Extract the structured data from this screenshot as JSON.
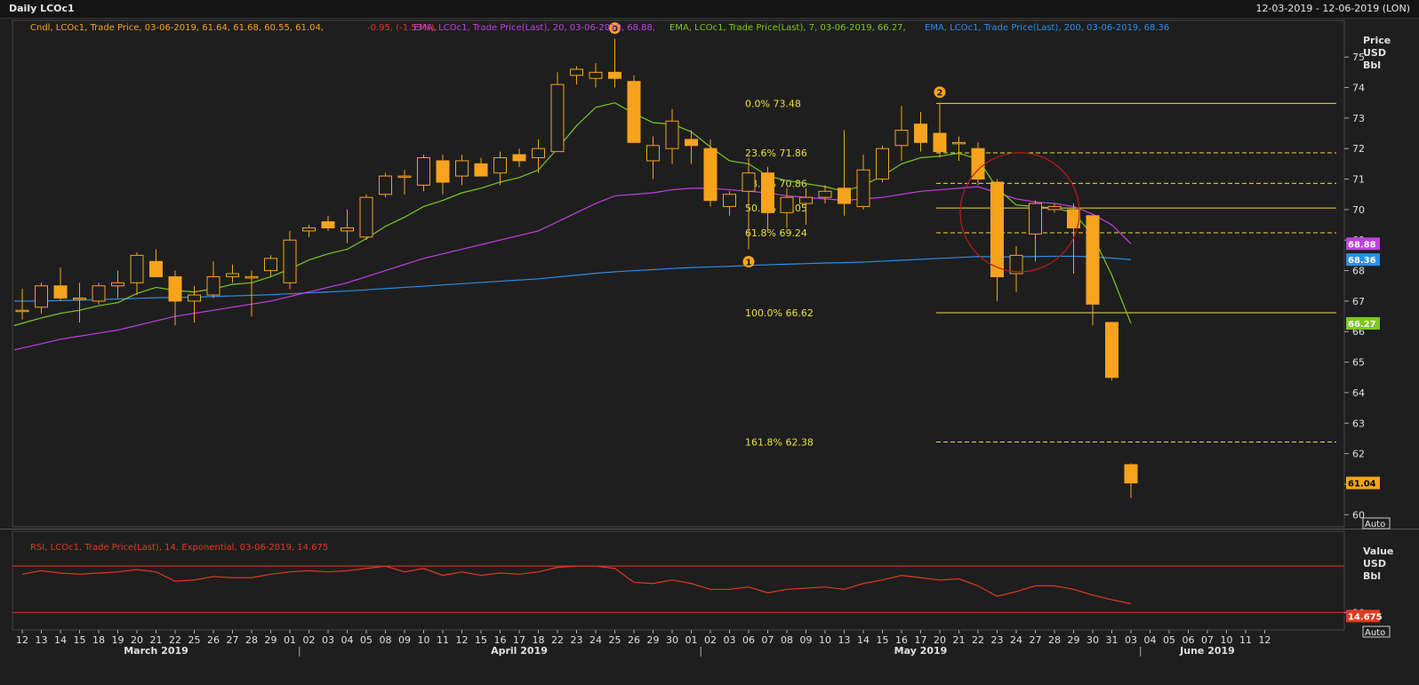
{
  "window": {
    "title": "Daily LCOc1",
    "date_range": "12-03-2019 - 12-06-2019 (LON)"
  },
  "legend": {
    "candle": "Cndl, LCOc1, Trade Price,  03-06-2019, 61.64, 61.68, 60.55, 61.04,",
    "candle_change": "-0.95, (-1.53%),",
    "ema20": "EMA, LCOc1, Trade Price(Last),  20, 03-06-2019, 68.88,",
    "ema7": "EMA, LCOc1, Trade Price(Last),  7, 03-06-2019, 66.27,",
    "ema200": "EMA, LCOc1, Trade Price(Last),  200, 03-06-2019, 68.36",
    "rsi": "RSI, LCOc1, Trade Price(Last),  14, Exponential, 03-06-2019, 14.675"
  },
  "axis": {
    "price_title": [
      "Price",
      "USD",
      "Bbl"
    ],
    "rsi_title": [
      "Value",
      "USD",
      "Bbl"
    ],
    "auto_label": "Auto",
    "months": [
      "March 2019",
      "April 2019",
      "May 2019",
      "June 2019"
    ]
  },
  "colors": {
    "bg": "#1e1e1e",
    "grid": "#3a3a3a",
    "candle_up": "#f7a31c",
    "ema20": "#c040e0",
    "ema7": "#7ec820",
    "ema200": "#2a8fe8",
    "fib": "#e8e040",
    "rsi": "#e03a20",
    "circle": "#c01818",
    "axis_text": "#e0e0e0"
  },
  "chart_data": {
    "type": "candlestick",
    "x": [
      "12",
      "13",
      "14",
      "15",
      "18",
      "19",
      "20",
      "21",
      "22",
      "25",
      "26",
      "27",
      "28",
      "29",
      "01",
      "02",
      "03",
      "04",
      "05",
      "08",
      "09",
      "10",
      "11",
      "12",
      "15",
      "16",
      "17",
      "18",
      "22",
      "23",
      "24",
      "25",
      "26",
      "29",
      "30",
      "01",
      "02",
      "03",
      "06",
      "07",
      "08",
      "09",
      "10",
      "13",
      "14",
      "15",
      "16",
      "17",
      "20",
      "21",
      "22",
      "23",
      "24",
      "27",
      "28",
      "29",
      "30",
      "31",
      "03"
    ],
    "x_future": [
      "04",
      "05",
      "06",
      "07",
      "10",
      "11",
      "12"
    ],
    "ohlc": [
      [
        66.7,
        67.4,
        66.4,
        66.7
      ],
      [
        66.8,
        67.6,
        66.6,
        67.5
      ],
      [
        67.5,
        68.1,
        67.0,
        67.1
      ],
      [
        67.1,
        67.6,
        66.3,
        67.1
      ],
      [
        67.0,
        67.6,
        66.9,
        67.5
      ],
      [
        67.5,
        68.0,
        67.1,
        67.6
      ],
      [
        67.6,
        68.6,
        67.2,
        68.5
      ],
      [
        68.3,
        68.7,
        67.8,
        67.8
      ],
      [
        67.8,
        68.0,
        66.2,
        67.0
      ],
      [
        67.0,
        67.5,
        66.3,
        67.2
      ],
      [
        67.2,
        68.3,
        67.1,
        67.8
      ],
      [
        67.8,
        68.2,
        67.6,
        67.9
      ],
      [
        67.8,
        68.0,
        66.5,
        67.8
      ],
      [
        68.0,
        68.5,
        67.8,
        68.4
      ],
      [
        67.6,
        69.3,
        67.4,
        69.0
      ],
      [
        69.3,
        69.5,
        69.1,
        69.4
      ],
      [
        69.6,
        69.8,
        69.3,
        69.4
      ],
      [
        69.3,
        70.0,
        68.9,
        69.4
      ],
      [
        69.1,
        70.5,
        69.0,
        70.4
      ],
      [
        70.5,
        71.2,
        70.4,
        71.1
      ],
      [
        71.1,
        71.3,
        70.5,
        71.1
      ],
      [
        70.8,
        71.8,
        70.6,
        71.7
      ],
      [
        71.6,
        71.8,
        70.5,
        70.9
      ],
      [
        71.1,
        71.8,
        70.8,
        71.6
      ],
      [
        71.5,
        71.7,
        71.1,
        71.1
      ],
      [
        71.2,
        71.9,
        70.8,
        71.7
      ],
      [
        71.8,
        72.0,
        71.4,
        71.6
      ],
      [
        71.7,
        72.3,
        71.2,
        72.0
      ],
      [
        71.9,
        74.5,
        71.9,
        74.1
      ],
      [
        74.4,
        74.7,
        74.1,
        74.6
      ],
      [
        74.3,
        74.8,
        74.0,
        74.5
      ],
      [
        74.5,
        75.6,
        74.0,
        74.3
      ],
      [
        74.2,
        74.4,
        72.3,
        72.2
      ],
      [
        71.6,
        72.4,
        71.0,
        72.1
      ],
      [
        72.0,
        73.3,
        71.5,
        72.9
      ],
      [
        72.3,
        72.6,
        71.5,
        72.1
      ],
      [
        72.0,
        72.3,
        70.1,
        70.3
      ],
      [
        70.1,
        70.6,
        69.8,
        70.5
      ],
      [
        70.6,
        71.7,
        68.7,
        71.2
      ],
      [
        71.2,
        71.4,
        69.3,
        69.9
      ],
      [
        69.9,
        70.7,
        69.4,
        70.4
      ],
      [
        70.2,
        70.7,
        69.5,
        70.4
      ],
      [
        70.4,
        70.8,
        70.2,
        70.6
      ],
      [
        70.7,
        72.6,
        69.8,
        70.2
      ],
      [
        70.1,
        71.8,
        70.0,
        71.3
      ],
      [
        71.0,
        72.1,
        70.9,
        72.0
      ],
      [
        72.1,
        73.4,
        71.6,
        72.6
      ],
      [
        72.8,
        73.2,
        71.9,
        72.2
      ],
      [
        72.5,
        73.5,
        71.7,
        71.9
      ],
      [
        72.2,
        72.4,
        71.6,
        72.2
      ],
      [
        72.0,
        72.2,
        70.8,
        71.0
      ],
      [
        70.9,
        71.0,
        67.0,
        67.8
      ],
      [
        67.9,
        68.8,
        67.3,
        68.5
      ],
      [
        69.2,
        70.3,
        68.3,
        70.2
      ],
      [
        70.0,
        70.2,
        69.9,
        70.1
      ],
      [
        70.0,
        70.2,
        67.9,
        69.4
      ],
      [
        69.8,
        69.8,
        66.2,
        66.9
      ],
      [
        66.3,
        66.3,
        64.4,
        64.5
      ],
      [
        61.64,
        61.68,
        60.55,
        61.04
      ]
    ],
    "ema20": [
      65.4,
      65.6,
      65.75,
      65.85,
      65.95,
      66.05,
      66.2,
      66.35,
      66.5,
      66.6,
      66.7,
      66.8,
      66.9,
      67.0,
      67.15,
      67.3,
      67.45,
      67.6,
      67.8,
      68.0,
      68.2,
      68.4,
      68.55,
      68.7,
      68.85,
      69.0,
      69.15,
      69.3,
      69.6,
      69.9,
      70.2,
      70.45,
      70.5,
      70.55,
      70.65,
      70.7,
      70.7,
      70.65,
      70.6,
      70.55,
      70.45,
      70.4,
      70.35,
      70.3,
      70.35,
      70.4,
      70.5,
      70.6,
      70.65,
      70.7,
      70.75,
      70.55,
      70.35,
      70.25,
      70.2,
      70.1,
      69.85,
      69.5,
      68.88
    ],
    "ema7": [
      66.2,
      66.45,
      66.6,
      66.7,
      66.85,
      66.95,
      67.25,
      67.45,
      67.35,
      67.3,
      67.4,
      67.55,
      67.6,
      67.8,
      68.05,
      68.35,
      68.55,
      68.7,
      69.05,
      69.45,
      69.75,
      70.1,
      70.3,
      70.55,
      70.7,
      70.9,
      71.05,
      71.3,
      72.0,
      72.75,
      73.35,
      73.5,
      73.15,
      72.85,
      72.8,
      72.55,
      72.05,
      71.6,
      71.5,
      71.1,
      70.95,
      70.85,
      70.75,
      70.6,
      70.8,
      71.1,
      71.5,
      71.7,
      71.75,
      71.85,
      71.65,
      70.7,
      70.15,
      70.1,
      70.05,
      69.9,
      69.15,
      67.85,
      66.27
    ],
    "ema200": [
      67.0,
      67.0,
      67.02,
      67.03,
      67.05,
      67.07,
      67.09,
      67.11,
      67.12,
      67.13,
      67.15,
      67.17,
      67.19,
      67.21,
      67.24,
      67.27,
      67.3,
      67.33,
      67.37,
      67.41,
      67.45,
      67.49,
      67.53,
      67.57,
      67.61,
      67.65,
      67.69,
      67.73,
      67.79,
      67.85,
      67.91,
      67.96,
      68.0,
      68.03,
      68.07,
      68.1,
      68.12,
      68.14,
      68.17,
      68.19,
      68.21,
      68.23,
      68.25,
      68.26,
      68.28,
      68.31,
      68.34,
      68.37,
      68.4,
      68.43,
      68.46,
      68.45,
      68.45,
      68.46,
      68.47,
      68.47,
      68.45,
      68.41,
      68.36
    ],
    "rsi": [
      63,
      66,
      64,
      63,
      64,
      65,
      67,
      65,
      57,
      58,
      61,
      60,
      60,
      63,
      65,
      66,
      65,
      66,
      68,
      70,
      65,
      68,
      62,
      65,
      62,
      64,
      63,
      65,
      69,
      70,
      70,
      68,
      56,
      55,
      58,
      55,
      50,
      50,
      52,
      47,
      50,
      51,
      52,
      50,
      55,
      58,
      62,
      60,
      58,
      59,
      53,
      44,
      48,
      53,
      53,
      50,
      45,
      41,
      37.6
    ],
    "rsi_levels": [
      70,
      30
    ],
    "fib": [
      {
        "label": "0.0%",
        "value": 73.48,
        "style": "solid"
      },
      {
        "label": "23.6%",
        "value": 71.86,
        "style": "dashed"
      },
      {
        "label": "38.2%",
        "value": 70.86,
        "style": "dashed"
      },
      {
        "label": "50.0%",
        "value": 70.05,
        "style": "solid"
      },
      {
        "label": "61.8%",
        "value": 69.24,
        "style": "dashed"
      },
      {
        "label": "100.0%",
        "value": 66.62,
        "style": "solid"
      },
      {
        "label": "161.8%",
        "value": 62.38,
        "style": "dashed"
      }
    ],
    "fib_start_index": 48,
    "markers": [
      {
        "label": "0",
        "index": 31,
        "value": 75.6,
        "pos": "above"
      },
      {
        "label": "1",
        "index": 38,
        "value": 68.7,
        "pos": "below"
      },
      {
        "label": "2",
        "index": 48,
        "value": 73.5,
        "pos": "above"
      }
    ],
    "price_ticks": [
      60,
      61,
      62,
      63,
      64,
      65,
      66,
      67,
      68,
      69,
      70,
      71,
      72,
      73,
      74,
      75
    ],
    "ylim": [
      59.6,
      76.2
    ],
    "rsi_ylim": [
      15,
      100
    ],
    "badges": [
      {
        "text": "68.88",
        "value": 68.88,
        "color": "#c040e0"
      },
      {
        "text": "68.36",
        "value": 68.36,
        "color": "#2a8fe8"
      },
      {
        "text": "66.27",
        "value": 66.27,
        "color": "#7ec820"
      },
      {
        "text": "61.04",
        "value": 61.04,
        "color": "#f7a31c"
      }
    ],
    "rsi_badge": {
      "text": "14.675",
      "value": 27,
      "color": "#e03a20"
    },
    "rsi_tick_label": "30",
    "month_label_index": [
      7,
      26,
      47,
      62
    ],
    "month_sep_index": [
      14.5,
      35.5,
      58.5
    ]
  }
}
